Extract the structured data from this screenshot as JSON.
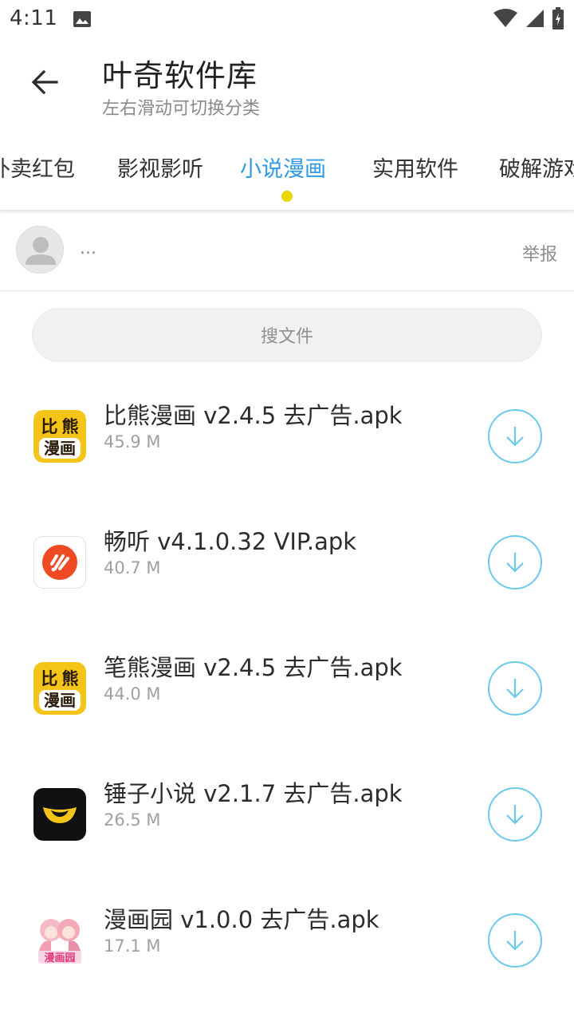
{
  "status_bar": {
    "time": "4:11",
    "icons": [
      "image-icon",
      "wifi-icon",
      "signal-icon",
      "battery-icon"
    ]
  },
  "appbar": {
    "back_icon": "arrow-left-icon",
    "title": "叶奇软件库",
    "subtitle": "左右滑动可切换分类"
  },
  "tabs": {
    "items": [
      {
        "label": "外卖红包"
      },
      {
        "label": "影视影听"
      },
      {
        "label": "小说漫画"
      },
      {
        "label": "实用软件"
      },
      {
        "label": "破解游戏"
      }
    ],
    "active_index": 2,
    "active_color": "#2f9ae6",
    "indicator_color": "#e8d800"
  },
  "poster": {
    "name": "...",
    "report_label": "举报"
  },
  "search": {
    "placeholder": "搜文件"
  },
  "files": [
    {
      "name": "比熊漫画 v2.4.5 去广告.apk",
      "size": "45.9 M",
      "icon": "bixiong-comic-icon",
      "icon_text": [
        "比",
        "熊",
        "漫画"
      ]
    },
    {
      "name": "畅听 v4.1.0.32 VIP.apk",
      "size": "40.7 M",
      "icon": "changting-app-icon"
    },
    {
      "name": "笔熊漫画 v2.4.5 去广告.apk",
      "size": "44.0 M",
      "icon": "bixiong-comic-icon",
      "icon_text": [
        "比",
        "熊",
        "漫画"
      ]
    },
    {
      "name": "锤子小说 v2.1.7 去广告.apk",
      "size": "26.5 M",
      "icon": "chuizi-novel-icon"
    },
    {
      "name": "漫画园 v1.0.0 去广告.apk",
      "size": "17.1 M",
      "icon": "manhuayuan-icon",
      "icon_text": [
        "漫画园"
      ]
    }
  ],
  "download_icon": "download-icon",
  "colors": {
    "download_ring": "#6cc9ee",
    "comic_yellow": "#f4c418",
    "changting_red": "#f04a24"
  }
}
